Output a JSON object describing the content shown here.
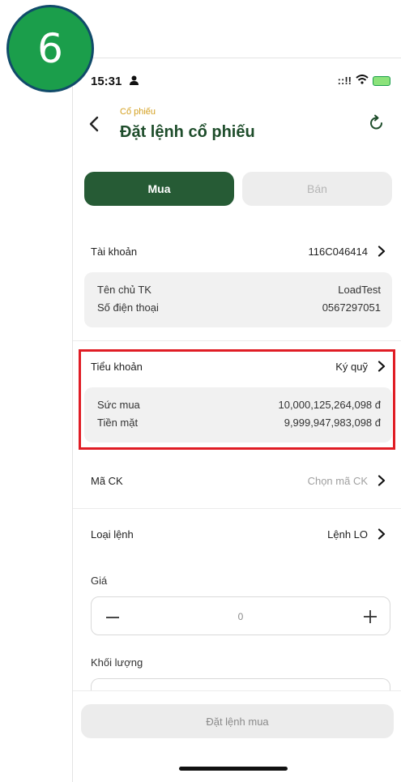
{
  "annotation": {
    "step_number": "6",
    "step_circle_color": "#1b9e4b",
    "highlight_color": "#e01d25"
  },
  "status_bar": {
    "time": "15:31",
    "person_icon": "person-icon",
    "signal": "::!!",
    "wifi_icon": "wifi-icon",
    "battery_icon": "battery-charging-icon"
  },
  "header": {
    "breadcrumb": "Cổ phiếu",
    "title": "Đặt lệnh cổ phiếu",
    "back_icon": "chevron-left-icon",
    "refresh_icon": "refresh-icon"
  },
  "tabs": [
    {
      "label": "Mua",
      "active": true
    },
    {
      "label": "Bán",
      "active": false
    }
  ],
  "account": {
    "label": "Tài khoản",
    "value": "116C046414",
    "details": [
      {
        "label": "Tên chủ TK",
        "value": "LoadTest"
      },
      {
        "label": "Số điện thoại",
        "value": "0567297051"
      }
    ]
  },
  "sub_account": {
    "label": "Tiểu khoản",
    "value": "Ký quỹ",
    "details": [
      {
        "label": "Sức mua",
        "value": "10,000,125,264,098 đ"
      },
      {
        "label": "Tiền mặt",
        "value": "9,999,947,983,098 đ"
      }
    ]
  },
  "symbol": {
    "label": "Mã CK",
    "placeholder": "Chọn mã CK"
  },
  "order_type": {
    "label": "Loại lệnh",
    "value": "Lệnh LO"
  },
  "price": {
    "label": "Giá",
    "value": "0",
    "minus": "−",
    "plus": "+"
  },
  "quantity": {
    "label": "Khối lượng"
  },
  "submit": {
    "label": "Đặt lệnh mua"
  },
  "colors": {
    "brand_dark_green": "#265b35",
    "title_green": "#1e4d2b",
    "breadcrumb_gold": "#d4a020"
  }
}
